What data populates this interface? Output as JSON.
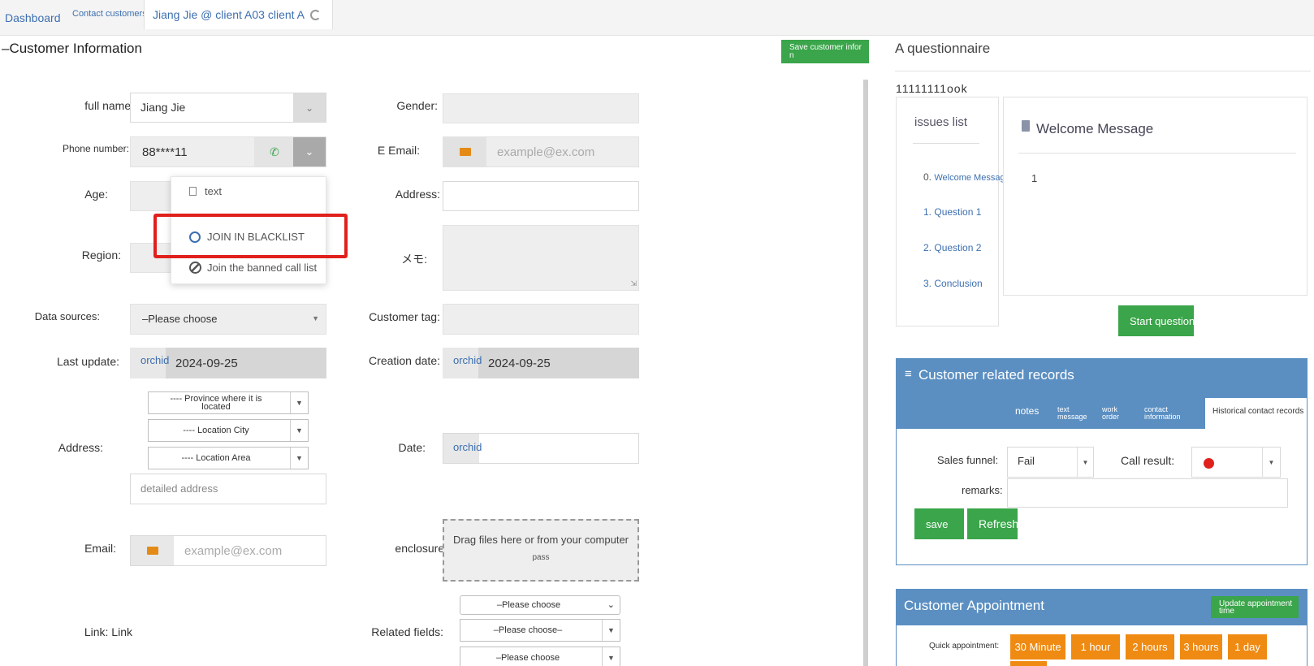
{
  "topbar": {
    "tab_dashboard": "Dashboard",
    "tab_contact": "Contact customers",
    "tab_active": "Jiang Jie @ client A03 client A"
  },
  "left": {
    "section_title": "–Customer Information",
    "save_button": "Save customer infor n",
    "labels": {
      "full_name": "full name:",
      "phone": "Phone number:",
      "age": "Age:",
      "region": "Region:",
      "data_sources": "Data sources:",
      "last_update": "Last update:",
      "address": "Address:",
      "email": "Email:",
      "link": "Link: Link",
      "gender": "Gender:",
      "e_email": "E Email:",
      "address2": "Address:",
      "memo": "メモ:",
      "customer_tag": "Customer tag:",
      "creation_date": "Creation date:",
      "date": "Date:",
      "enclosure": "enclosure:",
      "related_fields": "Related fields:"
    },
    "values": {
      "full_name": "Jiang Jie",
      "phone": "88****11",
      "data_sources": "–Please choose",
      "last_update_tag": "orchid",
      "last_update": "2024-09-25",
      "creation_tag": "orchid",
      "creation_date": "2024-09-25",
      "date_tag": "orchid",
      "province": "---- Province where it is located",
      "city": "---- Location City",
      "area": "---- Location Area",
      "detailed_address": "detailed address",
      "email_placeholder": "example@ex.com",
      "e_email_placeholder": "example@ex.com",
      "enclosure_main": "Drag files here or from your computer",
      "enclosure_sub": "pass",
      "related_1": "–Please choose",
      "related_2": "–Please choose–",
      "related_3": "–Please choose"
    },
    "dropdown": {
      "item_text": "text",
      "item_blacklist": "JOIN IN BLACKLIST",
      "item_banned": "Join the banned call list"
    }
  },
  "questionnaire": {
    "title": "A questionnaire",
    "code": "11111111ook",
    "issues_title": "issues list",
    "issues": [
      {
        "num": "0.",
        "label": "Welcome Message"
      },
      {
        "num": "1.",
        "label": "Question 1"
      },
      {
        "num": "2.",
        "label": "Question 2"
      },
      {
        "num": "3.",
        "label": "Conclusion"
      }
    ],
    "content_title": "Welcome Message",
    "content_body": "1",
    "start_button": "Start questionnaire"
  },
  "records": {
    "title": "Customer related records",
    "tabs": [
      "notes",
      "text message",
      "work order",
      "contact information",
      "Historical contact records"
    ],
    "sales_funnel_label": "Sales funnel:",
    "sales_funnel_value": "Fail",
    "call_result_label": "Call result:",
    "remarks_label": "remarks:",
    "save_button": "save",
    "refresh_button": "Refresh"
  },
  "appointment": {
    "title": "Customer Appointment",
    "update_button": "Update appointment time",
    "quick_label": "Quick appointment:",
    "quick_buttons": [
      "30 Minute",
      "1 hour",
      "2 hours",
      "3 hours",
      "1 day"
    ]
  },
  "colors": {
    "accent_blue": "#5b8fc2",
    "green": "#3aa54a",
    "orange": "#ef8a12",
    "highlight_red": "#e0201c"
  }
}
